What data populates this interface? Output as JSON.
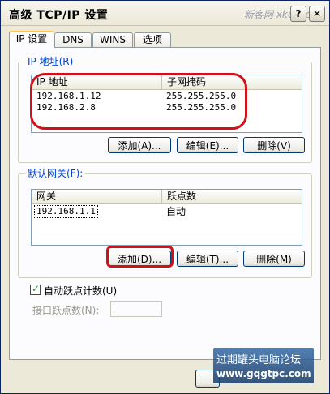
{
  "window": {
    "title": "高级 TCP/IP 设置",
    "watermark_top": "新客网 xker.com",
    "help_glyph": "?",
    "close_glyph": "✕"
  },
  "tabs": [
    {
      "label": "IP 设置",
      "active": true
    },
    {
      "label": "DNS",
      "active": false
    },
    {
      "label": "WINS",
      "active": false
    },
    {
      "label": "选项",
      "active": false
    }
  ],
  "ip_group": {
    "legend": "IP 地址(R)",
    "columns": [
      "IP 地址",
      "子网掩码"
    ],
    "rows": [
      {
        "ip": "192.168.1.12",
        "mask": "255.255.255.0"
      },
      {
        "ip": "192.168.2.8",
        "mask": "255.255.255.0"
      }
    ],
    "buttons": {
      "add": "添加(A)...",
      "edit": "编辑(E)...",
      "delete": "删除(V)"
    }
  },
  "gateway_group": {
    "legend": "默认网关(F):",
    "columns": [
      "网关",
      "跃点数"
    ],
    "rows": [
      {
        "gateway": "192.168.1.1",
        "metric": "自动"
      }
    ],
    "buttons": {
      "add": "添加(D)...",
      "edit": "编辑(T)...",
      "delete": "删除(M)"
    }
  },
  "auto_metric": {
    "label": "自动跃点计数(U)",
    "checked": true,
    "interface_metric_label": "接口跃点数(N):",
    "interface_metric_value": ""
  },
  "watermark": {
    "line1": "过期罐头电脑论坛",
    "line2": "www.gqgtpc.com"
  },
  "colors": {
    "legend_blue": "#0046d5",
    "highlight_red": "#d0101a",
    "tab_accent": "#ffc83c"
  }
}
